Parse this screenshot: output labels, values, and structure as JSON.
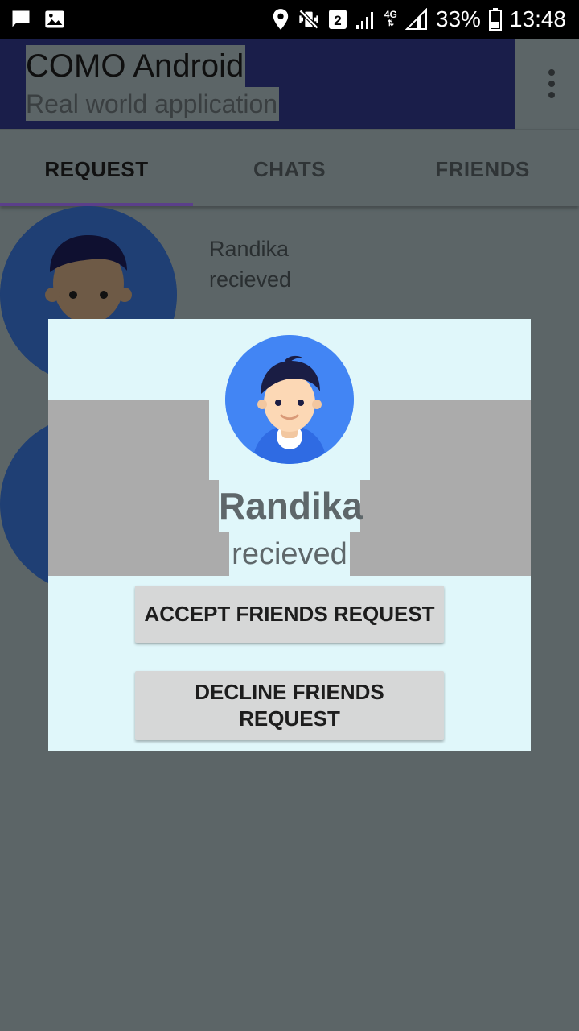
{
  "status_bar": {
    "icons_left": [
      "chat-icon",
      "image-icon"
    ],
    "sim_badge": "2",
    "network": "4G",
    "battery": "33%",
    "time": "13:48"
  },
  "app_bar": {
    "title": "COMO Android",
    "subtitle": "Real world application",
    "menu_icon": "more-vert-icon"
  },
  "tabs": [
    {
      "label": "REQUEST",
      "active": true
    },
    {
      "label": "CHATS",
      "active": false
    },
    {
      "label": "FRIENDS",
      "active": false
    }
  ],
  "list": [
    {
      "name": "Randika",
      "status": "recieved"
    }
  ],
  "dialog": {
    "name": "Randika",
    "status": "recieved",
    "accept_label": "ACCEPT FRIENDS REQUEST",
    "decline_label_line1": "DECLINE FRIENDS",
    "decline_label_line2": "REQUEST"
  },
  "colors": {
    "app_bar_dark": "#1a1e4a",
    "scrim": "#5c6567",
    "dialog_bg": "#e0f7fa",
    "avatar_blue": "#4285f4",
    "tab_indicator": "#5b3f8a"
  }
}
